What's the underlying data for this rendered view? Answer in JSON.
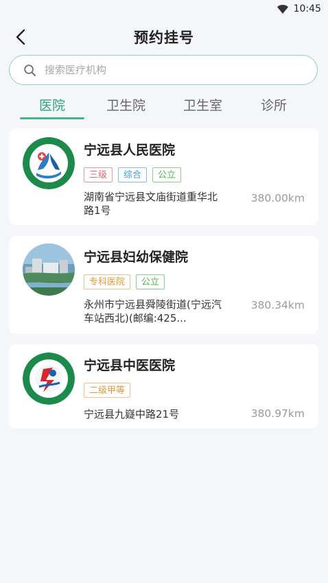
{
  "status": {
    "time": "10:45"
  },
  "header": {
    "title": "预约挂号"
  },
  "search": {
    "placeholder": "搜索医疗机构"
  },
  "tabs": [
    {
      "label": "医院",
      "active": true
    },
    {
      "label": "卫生院",
      "active": false
    },
    {
      "label": "卫生室",
      "active": false
    },
    {
      "label": "诊所",
      "active": false
    }
  ],
  "hospitals": [
    {
      "name": "宁远县人民医院",
      "tags": [
        "三级",
        "综合",
        "公立"
      ],
      "address": "湖南省宁远县文庙街道重华北路1号",
      "distance": "380.00km",
      "logo": "hospital-logo-icon"
    },
    {
      "name": "宁远县妇幼保健院",
      "tags": [
        "专科医院",
        "公立"
      ],
      "address": "永州市宁远县舜陵街道(宁远汽车站西北)(邮编:425...",
      "distance": "380.34km",
      "logo": "building-photo"
    },
    {
      "name": "宁远县中医医院",
      "tags": [
        "二级甲等"
      ],
      "address": "宁远县九嶷中路21号",
      "distance": "380.97km",
      "logo": "tcm-hospital-logo-icon"
    }
  ],
  "colors": {
    "accent": "#2aa671",
    "tag_red": "#e06a6a",
    "tag_blue": "#3f9ad6",
    "tag_green": "#49b84d",
    "tag_orange": "#e09a3a"
  }
}
